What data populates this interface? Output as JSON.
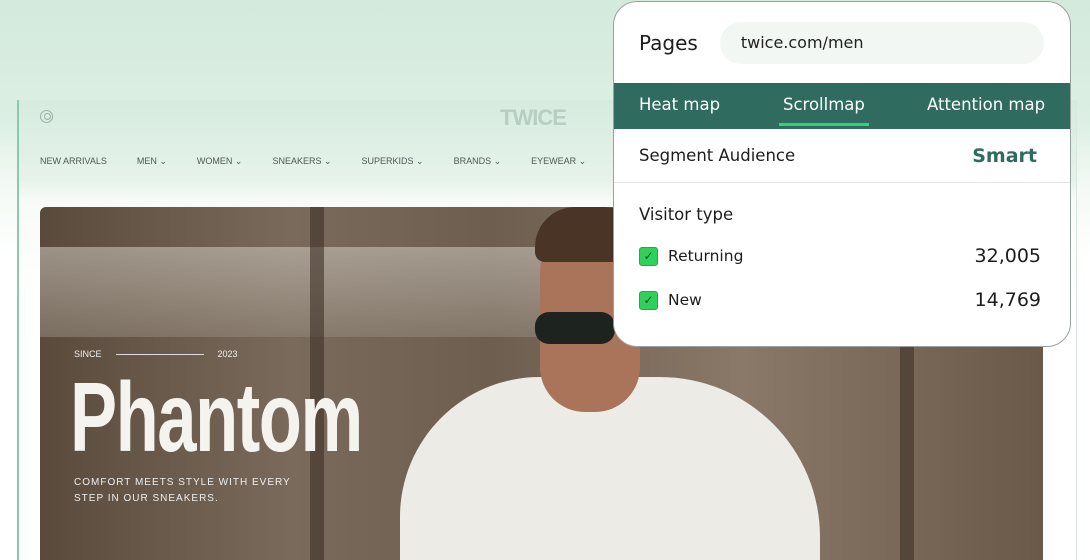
{
  "site": {
    "logo": "TWICE",
    "nav": [
      "NEW ARRIVALS",
      "MEN",
      "WOMEN",
      "SNEAKERS",
      "SUPERKIDS",
      "BRANDS",
      "EYEWEAR"
    ],
    "hero": {
      "since": "SINCE",
      "year": "2023",
      "title": "Phantom",
      "tagline": "COMFORT MEETS STYLE WITH EVERY STEP IN OUR SNEAKERS."
    }
  },
  "panel": {
    "pages_label": "Pages",
    "url": "twice.com/men",
    "tabs": [
      "Heat map",
      "Scrollmap",
      "Attention map"
    ],
    "active_tab": "Scrollmap",
    "segment_label": "Segment Audience",
    "segment_value": "Smart",
    "visitor_type_label": "Visitor type",
    "visitors": [
      {
        "label": "Returning",
        "count": "32,005",
        "checked": true
      },
      {
        "label": "New",
        "count": "14,769",
        "checked": true
      }
    ]
  },
  "colors": {
    "accent": "#2f6b5e",
    "checkbox": "#2fd15a",
    "tab_underline": "#33d17a"
  }
}
